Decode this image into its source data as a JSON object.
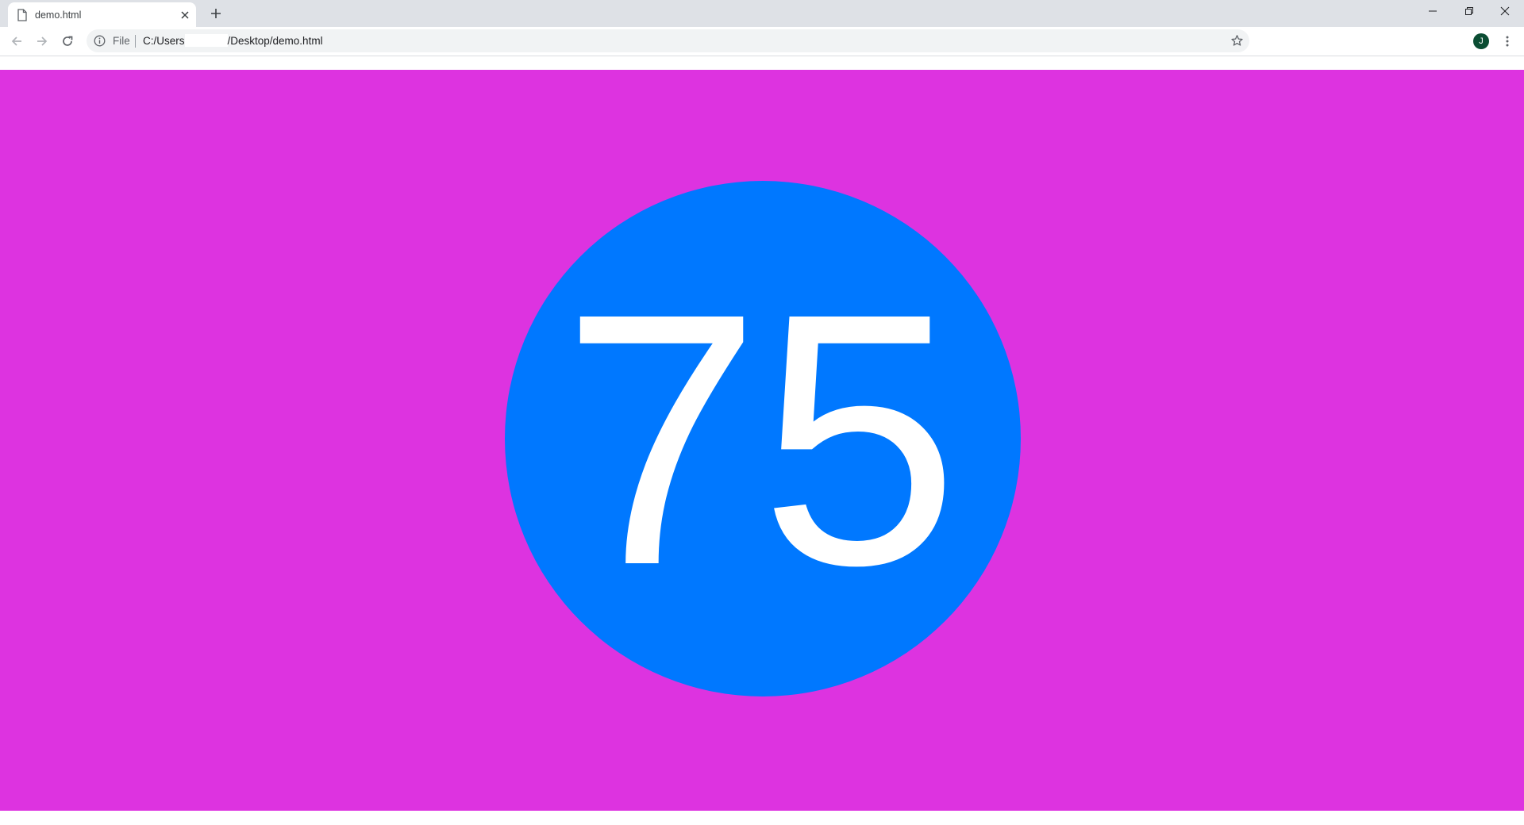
{
  "browser": {
    "tab": {
      "title": "demo.html",
      "icon": "file-icon"
    },
    "omnibox": {
      "scheme_chip": "File",
      "url_prefix": "C:/Users",
      "url_suffix": "/Desktop/demo.html"
    },
    "profile_initial": "J",
    "colors": {
      "tabbar": "#dee1e6",
      "omnibox": "#f1f3f4",
      "avatar": "#0b4d33"
    }
  },
  "page": {
    "number": "75",
    "colors": {
      "background": "#dd33e0",
      "circle": "#0078ff",
      "text": "#ffffff"
    }
  }
}
